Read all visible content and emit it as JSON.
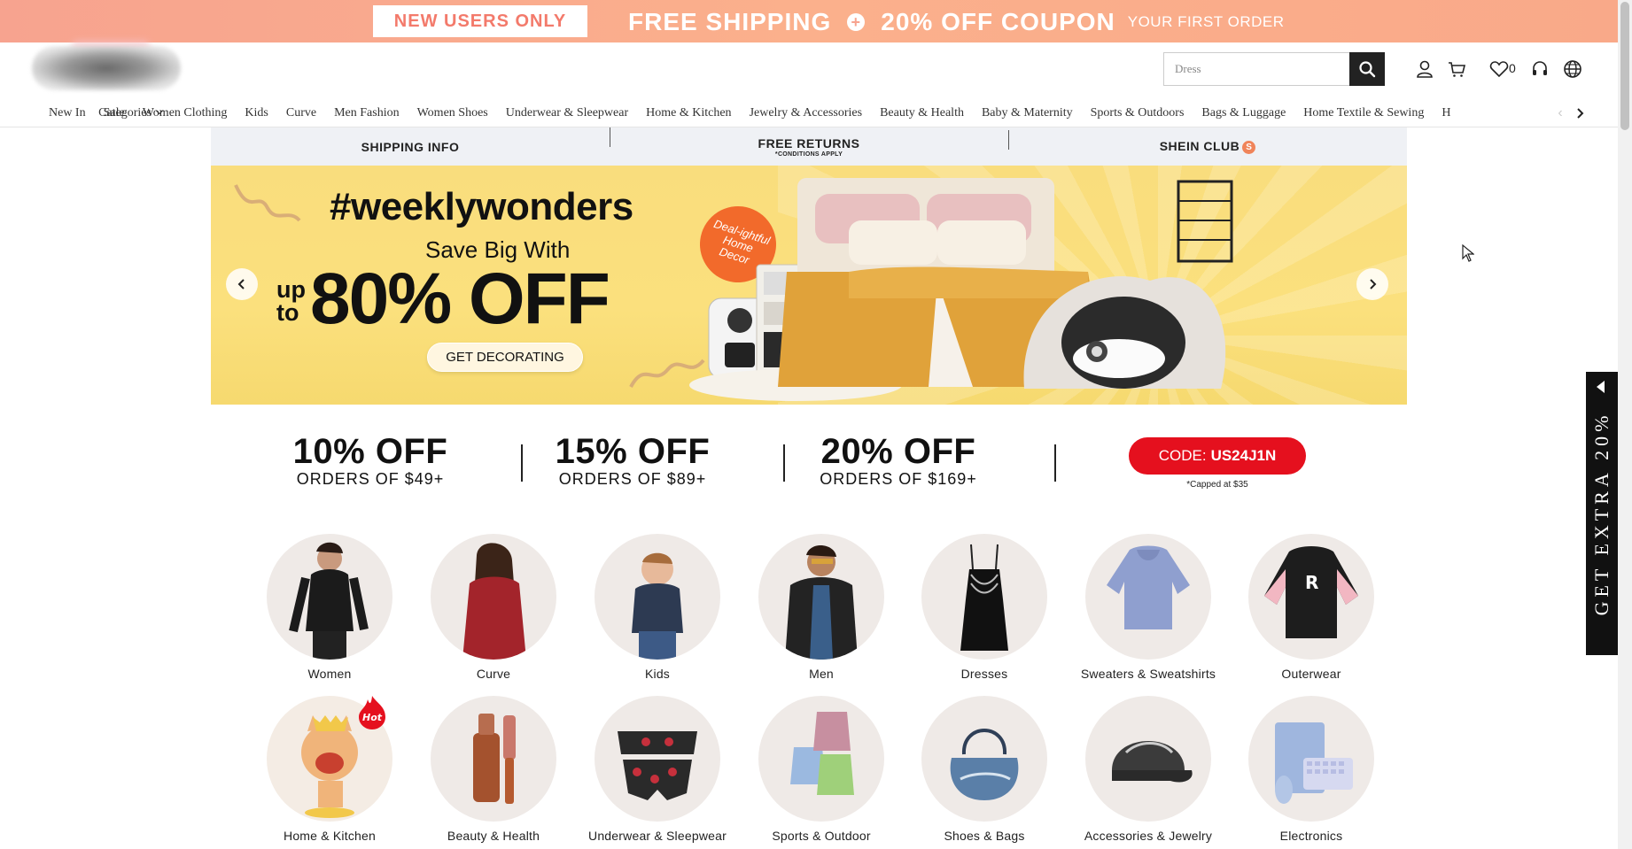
{
  "promo": {
    "new_users": "NEW USERS ONLY",
    "free_shipping": "FREE SHIPPING",
    "coupon": "20% OFF COUPON",
    "first_order": "YOUR FIRST ORDER"
  },
  "header": {
    "search_placeholder": "Dress",
    "wishlist_count": "0",
    "icons": [
      "user-icon",
      "cart-icon",
      "heart-icon",
      "headset-icon",
      "globe-icon"
    ]
  },
  "nav": {
    "items": [
      "Categories",
      "New In",
      "Sale",
      "Women Clothing",
      "Kids",
      "Curve",
      "Men Fashion",
      "Women Shoes",
      "Underwear & Sleepwear",
      "Home & Kitchen",
      "Jewelry & Accessories",
      "Beauty & Health",
      "Baby & Maternity",
      "Sports & Outdoors",
      "Bags & Luggage",
      "Home Textile & Sewing",
      "H"
    ]
  },
  "info_strip": {
    "shipping": "SHIPPING INFO",
    "returns": "FREE RETURNS",
    "returns_sub": "*CONDITIONS APPLY",
    "club": "SHEIN CLUB",
    "club_badge": "S"
  },
  "hero": {
    "title": "#weeklywonders",
    "save": "Save Big With",
    "up": "up",
    "to": "to",
    "off": "80% OFF",
    "badge": "Deal-ightful Home Decor",
    "cta": "GET DECORATING"
  },
  "coupons": [
    {
      "off": "10% OFF",
      "orders": "ORDERS OF $49+"
    },
    {
      "off": "15% OFF",
      "orders": "ORDERS OF $89+"
    },
    {
      "off": "20% OFF",
      "orders": "ORDERS OF $169+"
    }
  ],
  "code": {
    "label": "CODE:",
    "value": "US24J1N",
    "capped": "*Capped at $35"
  },
  "categories": [
    "Women",
    "Curve",
    "Kids",
    "Men",
    "Dresses",
    "Sweaters & Sweatshirts",
    "Outerwear",
    "Home & Kitchen",
    "Beauty & Health",
    "Underwear & Sleepwear",
    "Sports & Outdoor",
    "Shoes & Bags",
    "Accessories & Jewelry",
    "Electronics"
  ],
  "hot_badge": "Hot",
  "side_tab": "GET EXTRA 20%",
  "colors": {
    "promo_bg": "#fbb08c",
    "code_red": "#e5101e",
    "hero_yellow": "#fbe07d"
  }
}
